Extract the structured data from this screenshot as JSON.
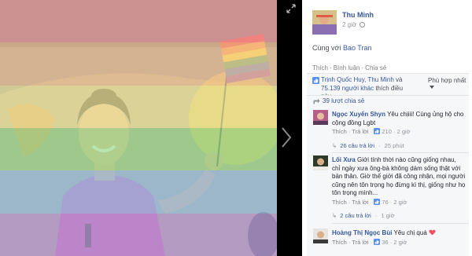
{
  "viewer": {
    "rainbow": [
      "#f7a8a6",
      "#f5c79a",
      "#efe89c",
      "#9cdb8f",
      "#98c2e3",
      "#b89bd9"
    ]
  },
  "post": {
    "author": "Thu Minh",
    "time": "2 giờ",
    "with_prefix": "Cùng với",
    "with_name": "Bao Tran",
    "actions": {
      "like": "Thích",
      "comment": "Bình luận",
      "share": "Chia sẻ"
    },
    "likes": {
      "names": "Trịnh Quốc Huy, Thu Minh",
      "conj": "và",
      "others": "75.139 người khác",
      "suffix": "thích điều này."
    },
    "sort": "Phù hợp nhất",
    "shares": "39 lượt chia sẻ"
  },
  "comments": [
    {
      "name": "Ngọc Xuyến Shyn",
      "text": "Yêu chịiii! Cùng ủng hộ cho cộng đồng Lgbt",
      "like": "Thích",
      "reply": "Trả lời",
      "likes_count": "210",
      "time": "2 giờ",
      "replies": "26 câu trả lời",
      "replies_time": "25 phút"
    },
    {
      "name": "Lối Xưa",
      "text": "Giới tính thời nào cũng giống nhau, chỉ ngày xưa ông-bà không dám sống thật với bản thân. Giờ thế giới đã công nhận, mọi người cũng nên tôn trọng họ đừng kì thị, giống như họ tôn trọng mình...",
      "like": "Thích",
      "reply": "Trả lời",
      "likes_count": "76",
      "time": "2 giờ",
      "replies": "2 câu trả lời",
      "replies_time": "1 giờ"
    },
    {
      "name": "Hoàng Thị Ngọc Bùi",
      "text": "Yêu chị quá",
      "like": "Thích",
      "reply": "Trả lời",
      "likes_count": "36",
      "time": "2 giờ"
    }
  ]
}
